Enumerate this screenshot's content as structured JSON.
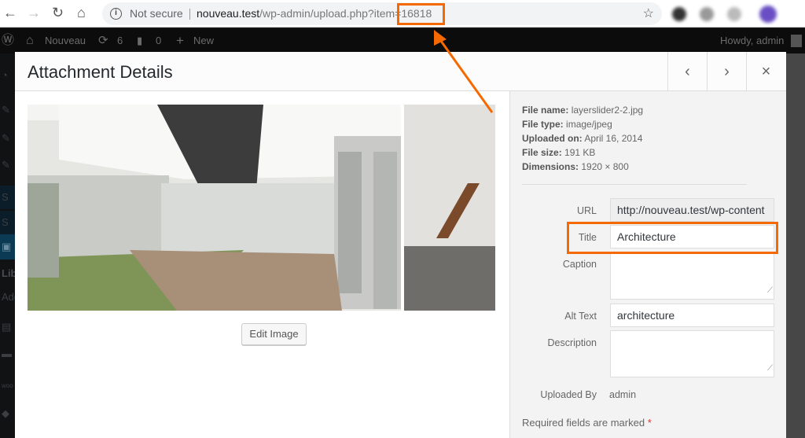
{
  "browser": {
    "security": "Not secure",
    "url_host": "nouveau.test",
    "url_path": "/wp-admin/upload.php?item=16818"
  },
  "adminbar": {
    "site": "Nouveau",
    "updates": "6",
    "comments": "0",
    "new": "New",
    "greeting": "Howdy, admin"
  },
  "sidebar": {
    "items": [
      "S",
      "S",
      "Lib",
      "Add"
    ]
  },
  "modal": {
    "title": "Attachment Details",
    "prev": "‹",
    "next": "›",
    "close": "×",
    "edit_image": "Edit Image"
  },
  "details": {
    "file_name_label": "File name:",
    "file_name": "layerslider2-2.jpg",
    "file_type_label": "File type:",
    "file_type": "image/jpeg",
    "uploaded_on_label": "Uploaded on:",
    "uploaded_on": "April 16, 2014",
    "file_size_label": "File size:",
    "file_size": "191 KB",
    "dimensions_label": "Dimensions:",
    "dimensions": "1920 × 800"
  },
  "fields": {
    "url_label": "URL",
    "url": "http://nouveau.test/wp-content",
    "title_label": "Title",
    "title": "Architecture",
    "caption_label": "Caption",
    "caption": "",
    "alt_label": "Alt Text",
    "alt": "architecture",
    "description_label": "Description",
    "description": "",
    "uploaded_by_label": "Uploaded By",
    "uploaded_by": "admin",
    "required_note": "Required fields are marked",
    "required_star": "*"
  },
  "colors": {
    "highlight": "#f56a00"
  }
}
